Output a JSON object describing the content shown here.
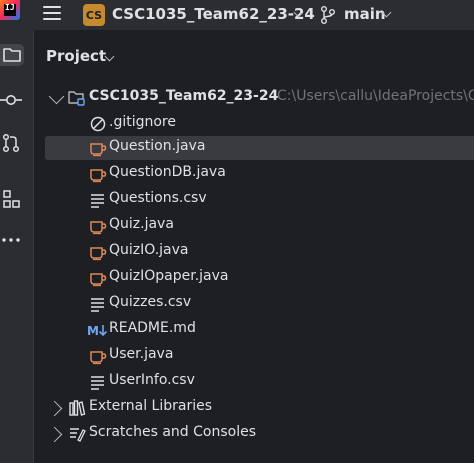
{
  "titlebar": {
    "app_logo_text": "IJ",
    "project_badge": "CS",
    "project_name": "CSC1035_Team62_23-24",
    "branch": "main"
  },
  "toolstrip": {
    "icons": [
      "folder-icon",
      "commit-icon",
      "pull-requests-icon",
      "structure-icon",
      "more-icon"
    ]
  },
  "panel": {
    "title": "Project"
  },
  "tree": {
    "root": {
      "name": "CSC1035_Team62_23-24",
      "path": "C:\\Users\\callu\\IdeaProjects\\C"
    },
    "files": [
      {
        "name": ".gitignore",
        "icon": "gitignore-icon"
      },
      {
        "name": "Question.java",
        "icon": "java-icon",
        "selected": true
      },
      {
        "name": "QuestionDB.java",
        "icon": "java-icon"
      },
      {
        "name": "Questions.csv",
        "icon": "text-file-icon"
      },
      {
        "name": "Quiz.java",
        "icon": "java-icon"
      },
      {
        "name": "QuizIO.java",
        "icon": "java-icon"
      },
      {
        "name": "QuizIOpaper.java",
        "icon": "java-icon"
      },
      {
        "name": "Quizzes.csv",
        "icon": "text-file-icon"
      },
      {
        "name": "README.md",
        "icon": "markdown-icon"
      },
      {
        "name": "User.java",
        "icon": "java-icon"
      },
      {
        "name": "UserInfo.csv",
        "icon": "text-file-icon"
      }
    ],
    "external_libraries": "External Libraries",
    "scratches": "Scratches and Consoles"
  },
  "colors": {
    "background": "#1e1f22",
    "chrome": "#2b2d30",
    "selection": "#393b40",
    "java_icon": "#e08855",
    "badge": "#c5892e",
    "markdown": "#6fa7f5"
  }
}
